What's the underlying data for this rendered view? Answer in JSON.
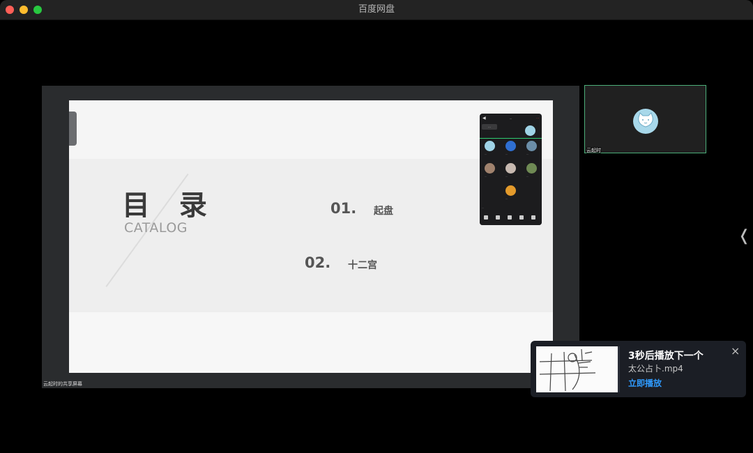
{
  "window": {
    "title": "百度网盘"
  },
  "share": {
    "label": "云起时的共享屏幕"
  },
  "slide": {
    "title": "目 录",
    "subtitle": "CATALOG",
    "items": [
      {
        "number": "01.",
        "text": "起盘"
      },
      {
        "number": "02.",
        "text": "十二宫"
      }
    ]
  },
  "phone_overlay": {
    "header": "...",
    "end_label": "...",
    "chip": "...",
    "input_placeholder": "...",
    "participants": [
      {
        "label": "...",
        "color": "#9fd3e6"
      },
      {
        "label": "...",
        "color": "#2f6fd1"
      },
      {
        "label": "...",
        "color": "#6b8ea8"
      },
      {
        "label": "...",
        "color": "#a0826d"
      },
      {
        "label": "...",
        "color": "#c7b9b0"
      },
      {
        "label": "...",
        "color": "#6f8a54"
      },
      {
        "label": "...",
        "color": "#e39a2b"
      },
      {
        "label": "...",
        "color": "#9fd3e6"
      }
    ]
  },
  "participant_tile": {
    "name": "云起时",
    "avatar_color": "#a8d8ea"
  },
  "next_up": {
    "heading": "3秒后播放下一个",
    "file_name": "太公占卜.mp4",
    "play_now": "立即播放",
    "close_icon": "×"
  },
  "collapse_icon": "❬",
  "colors": {
    "accent_blue": "#2f9bff",
    "tile_border": "#4caf7a"
  }
}
